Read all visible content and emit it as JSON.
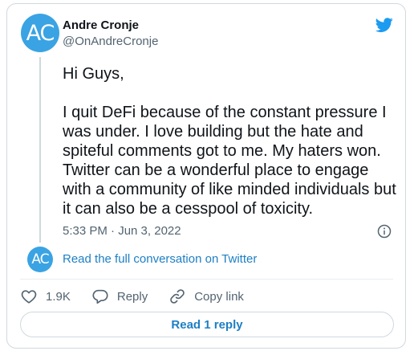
{
  "author": {
    "initials": "AC",
    "name": "Andre Cronje",
    "handle": "@OnAndreCronje"
  },
  "tweet": {
    "text": "Hi Guys,\n\nI quit DeFi because of the constant pressure I was under. I love building but the hate and spiteful comments got to me. My haters won. Twitter can be a wonderful place to engage with a community of like minded individuals but it can also be a cesspool of toxicity.",
    "timestamp": "5:33 PM · Jun 3, 2022"
  },
  "conversation": {
    "avatar_initials": "AC",
    "link_label": "Read the full conversation on Twitter"
  },
  "actions": {
    "like_count": "1.9K",
    "reply_label": "Reply",
    "copy_label": "Copy link"
  },
  "read_reply_label": "Read 1 reply",
  "colors": {
    "accent": "#1d9bf0",
    "avatar_bg": "#3aa3e3",
    "muted": "#536471"
  }
}
